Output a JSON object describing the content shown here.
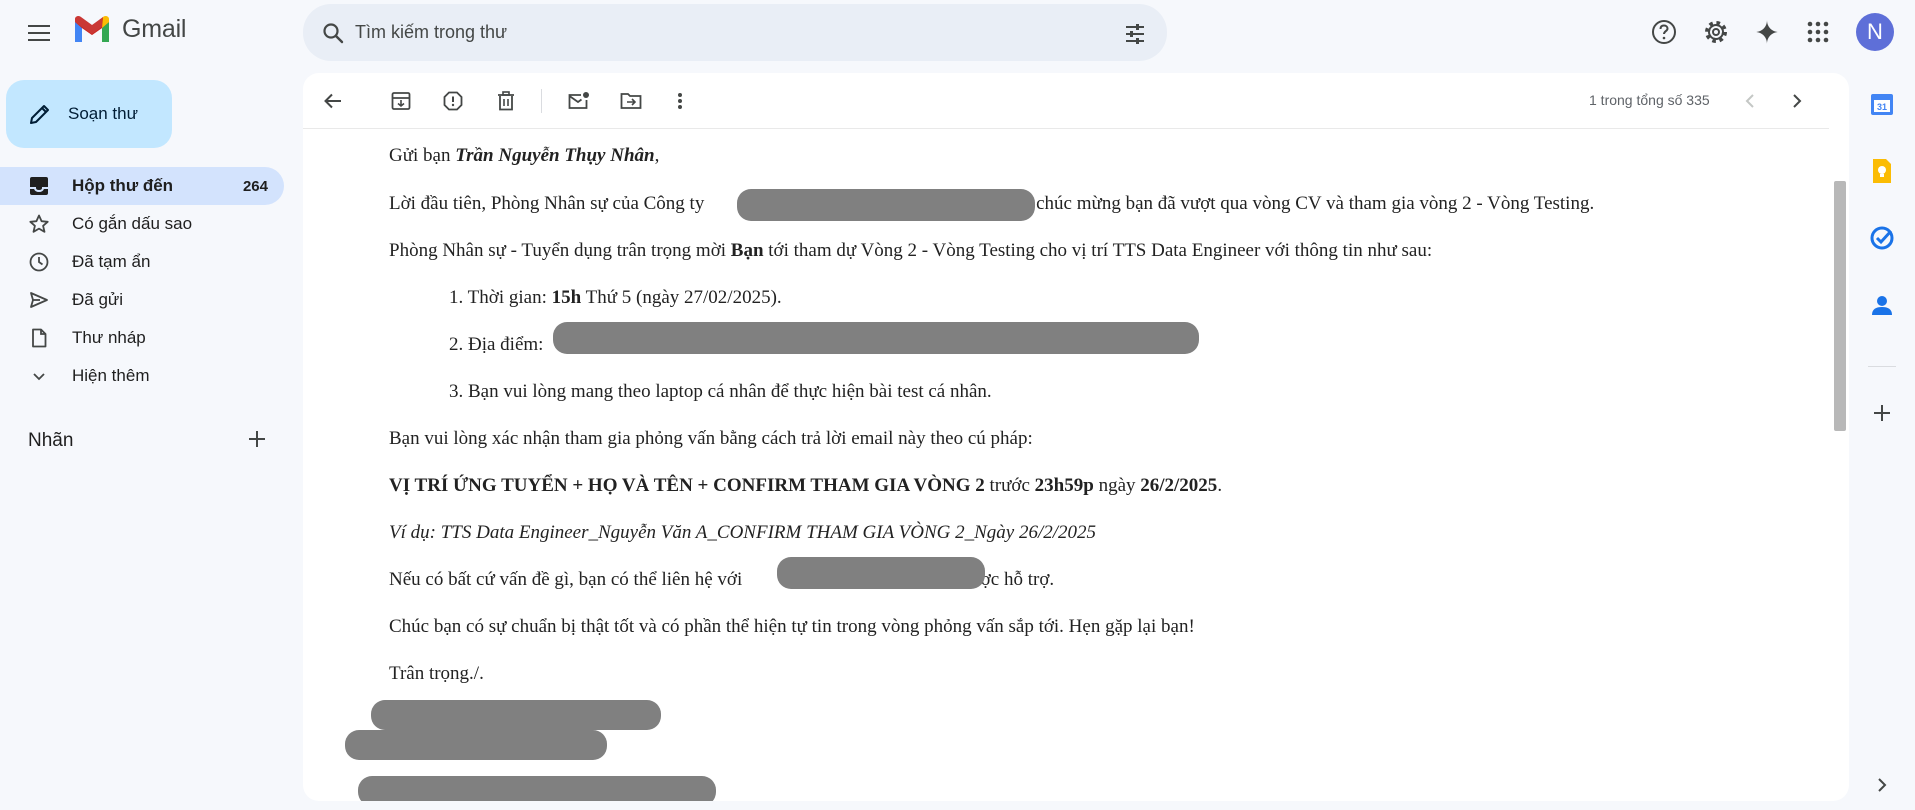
{
  "app": {
    "name": "Gmail"
  },
  "search": {
    "placeholder": "Tìm kiếm trong thư"
  },
  "user": {
    "avatar_letter": "N",
    "avatar_color": "#5e6fd8"
  },
  "compose": {
    "label": "Soạn thư"
  },
  "sidebar": {
    "items": [
      {
        "label": "Hộp thư đến",
        "count": "264",
        "icon": "inbox-icon",
        "active": true
      },
      {
        "label": "Có gắn dấu sao",
        "count": "",
        "icon": "star-icon"
      },
      {
        "label": "Đã tạm ẩn",
        "count": "",
        "icon": "clock-icon"
      },
      {
        "label": "Đã gửi",
        "count": "",
        "icon": "send-icon"
      },
      {
        "label": "Thư nháp",
        "count": "",
        "icon": "draft-icon"
      },
      {
        "label": "Hiện thêm",
        "count": "",
        "icon": "chevron-down-icon"
      }
    ],
    "labels_heading": "Nhãn"
  },
  "toolbar": {
    "pager_text": "1 trong tổng số 335"
  },
  "email": {
    "greeting_prefix": "Gửi bạn ",
    "greeting_name": "Trần Nguyễn Thụy Nhân",
    "greeting_suffix": ",",
    "p1_prefix": "Lời đầu tiên, Phòng Nhân sự của Công ty",
    "p1_suffix": " xin chúc mừng bạn đã vượt qua vòng CV và tham gia vòng 2 - Vòng Testing.",
    "p2_prefix": "Phòng Nhân sự - Tuyển dụng trân trọng mời ",
    "p2_bold": "Bạn",
    "p2_suffix": " tới tham dự Vòng 2 - Vòng Testing cho vị trí TTS Data Engineer với thông tin như sau:",
    "list1_num": "1.",
    "list1_prefix": "Thời gian: ",
    "list1_bold": "15h",
    "list1_suffix": " Thứ 5 (ngày 27/02/2025).",
    "list2_num": "2.",
    "list2_text": "Địa điểm:",
    "list3_num": "3.",
    "list3_text": "Bạn vui lòng mang theo laptop cá nhân để thực hiện bài test cá nhân.",
    "p3": "Bạn vui lòng xác nhận tham gia phỏng vấn bằng cách trả lời email này theo cú pháp:",
    "p4_bold1": "VỊ TRÍ ỨNG TUYỂN + HỌ VÀ TÊN + CONFIRM THAM GIA VÒNG 2",
    "p4_mid1": " trước ",
    "p4_bold2": "23h59p",
    "p4_mid2": " ngày ",
    "p4_bold3": "26/2/2025",
    "p4_end": ".",
    "p5_italic": "Ví dụ: TTS Data Engineer_Nguyễn Văn A_CONFIRM THAM GIA VÒNG 2_Ngày 26/2/2025",
    "p6_prefix": "Nếu có bất cứ vấn đề gì, bạn có thể liên hệ với",
    "p6_suffix": "để được hỗ trợ.",
    "p7": "Chúc bạn có sự chuẩn bị thật tốt và có phần thể hiện tự tin trong vòng phỏng vấn sắp tới. Hẹn gặp lại bạn!",
    "p8": "Trân trọng./."
  }
}
